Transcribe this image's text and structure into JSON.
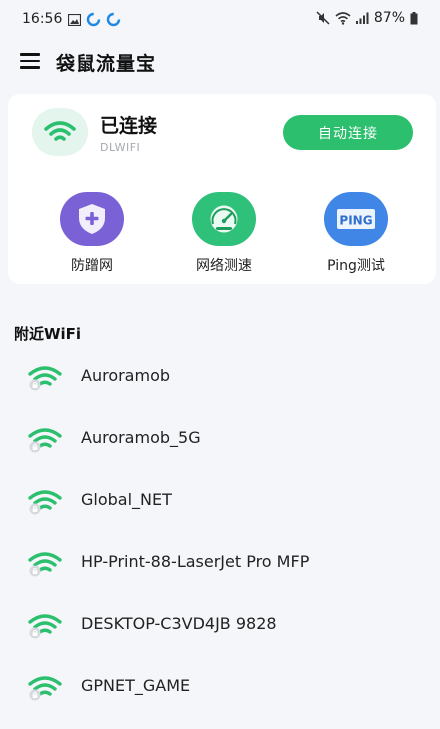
{
  "status_bar": {
    "time": "16:56",
    "battery": "87%",
    "icons": [
      "image-icon",
      "sync-icon",
      "sync-icon",
      "mute-icon",
      "wifi-icon",
      "signal-icon",
      "battery-icon"
    ]
  },
  "header": {
    "title": "袋鼠流量宝",
    "menu_icon": "menu-icon"
  },
  "connection": {
    "status": "已连接",
    "ssid": "DLWIFI",
    "auto_connect_label": "自动连接",
    "accent_color": "#2bbf6e"
  },
  "tools": [
    {
      "label": "防蹭网",
      "icon": "shield-plus-icon",
      "color": "#7a62d6"
    },
    {
      "label": "网络测速",
      "icon": "speedometer-icon",
      "color": "#2fc07a"
    },
    {
      "label": "Ping测试",
      "icon": "ping-icon",
      "color": "#3f86e6",
      "icon_text": "PING"
    }
  ],
  "nearby": {
    "title": "附近WiFi",
    "networks": [
      {
        "name": "Auroramob",
        "locked": true
      },
      {
        "name": "Auroramob_5G",
        "locked": true
      },
      {
        "name": "Global_NET",
        "locked": true
      },
      {
        "name": "HP-Print-88-LaserJet Pro MFP",
        "locked": true
      },
      {
        "name": "DESKTOP-C3VD4JB 9828",
        "locked": true
      },
      {
        "name": "GPNET_GAME",
        "locked": true
      }
    ]
  }
}
